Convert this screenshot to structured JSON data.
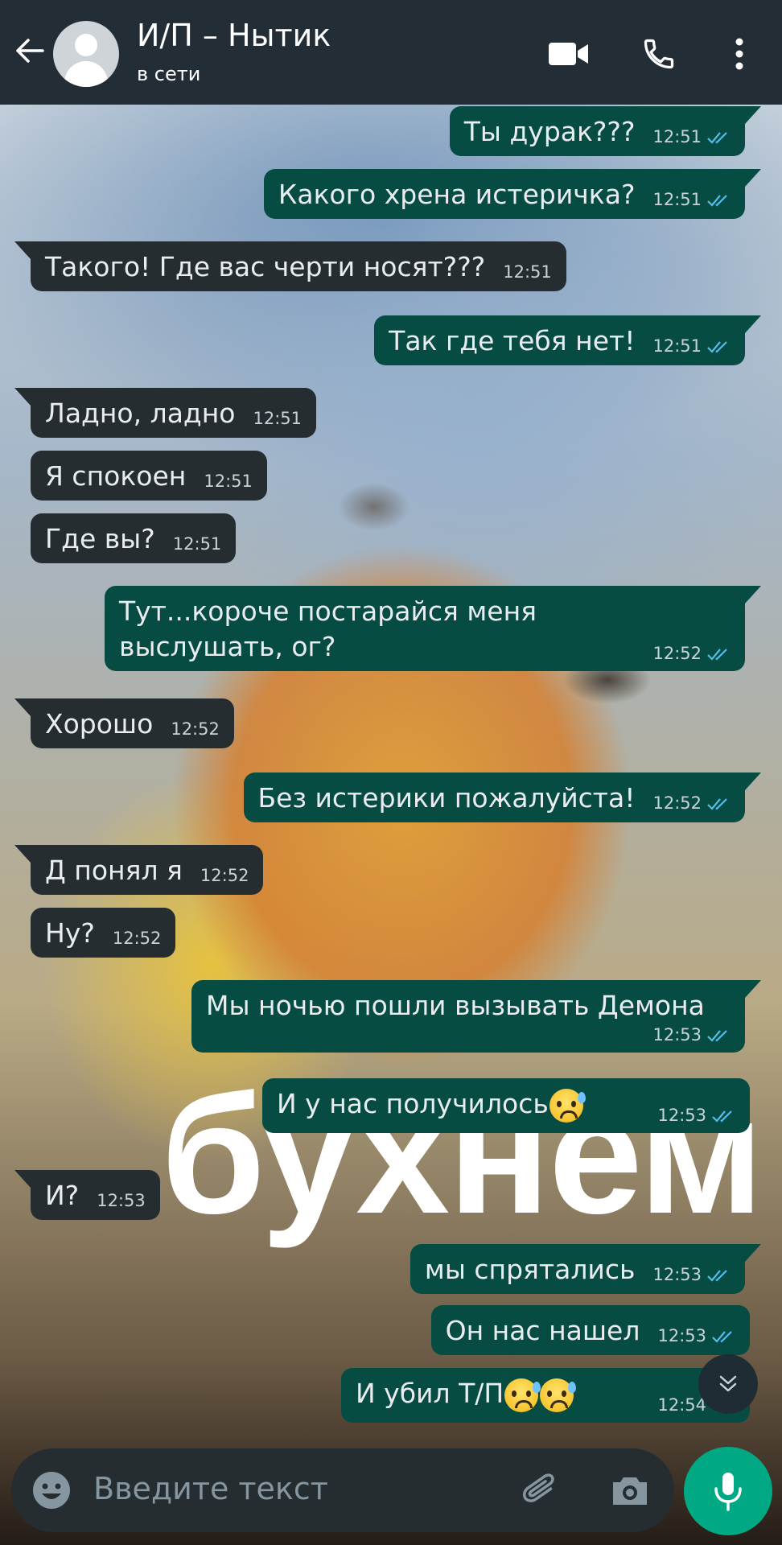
{
  "header": {
    "contact_name": "И/П – Нытик",
    "status": "в сети",
    "icons": [
      "back-arrow-icon",
      "avatar",
      "video-call-icon",
      "voice-call-icon",
      "more-options-icon"
    ]
  },
  "wallpaper": {
    "caption": "бухнем"
  },
  "messages": [
    {
      "dir": "out",
      "text": "Ты дурак???",
      "time": "12:51"
    },
    {
      "dir": "out",
      "text": "Какого хрена истеричка?",
      "time": "12:51"
    },
    {
      "dir": "in",
      "text": "Такого! Где вас черти носят???",
      "time": "12:51"
    },
    {
      "dir": "out",
      "text": "Так где тебя нет!",
      "time": "12:51"
    },
    {
      "dir": "in",
      "text": "Ладно, ладно",
      "time": "12:51"
    },
    {
      "dir": "in",
      "text": "Я спокоен",
      "time": "12:51"
    },
    {
      "dir": "in",
      "text": "Где вы?",
      "time": "12:51"
    },
    {
      "dir": "out",
      "text": "Тут...короче постарайся меня выслушать, ог?",
      "time": "12:52"
    },
    {
      "dir": "in",
      "text": "Хорошо",
      "time": "12:52"
    },
    {
      "dir": "out",
      "text": "Без истерики пожалуйста!",
      "time": "12:52"
    },
    {
      "dir": "in",
      "text": "Д понял я",
      "time": "12:52"
    },
    {
      "dir": "in",
      "text": "Ну?",
      "time": "12:52"
    },
    {
      "dir": "out",
      "text": "Мы ночью пошли вызывать Демона",
      "time": "12:53"
    },
    {
      "dir": "out",
      "text": "И у нас получилось",
      "time": "12:53"
    },
    {
      "dir": "in",
      "text": "И?",
      "time": "12:53"
    },
    {
      "dir": "out",
      "text": "мы спрятались",
      "time": "12:53"
    },
    {
      "dir": "out",
      "text": "Он нас нашел",
      "time": "12:53"
    },
    {
      "dir": "out",
      "text": "И убил Т/П",
      "time": "12:54"
    }
  ],
  "input": {
    "placeholder": "Введите текст"
  },
  "colors": {
    "header_bg": "#232d36",
    "outgoing_bubble": "#074c43",
    "incoming_bubble": "#262d31",
    "read_ticks": "#53bdeb",
    "mic_button": "#00a884"
  }
}
